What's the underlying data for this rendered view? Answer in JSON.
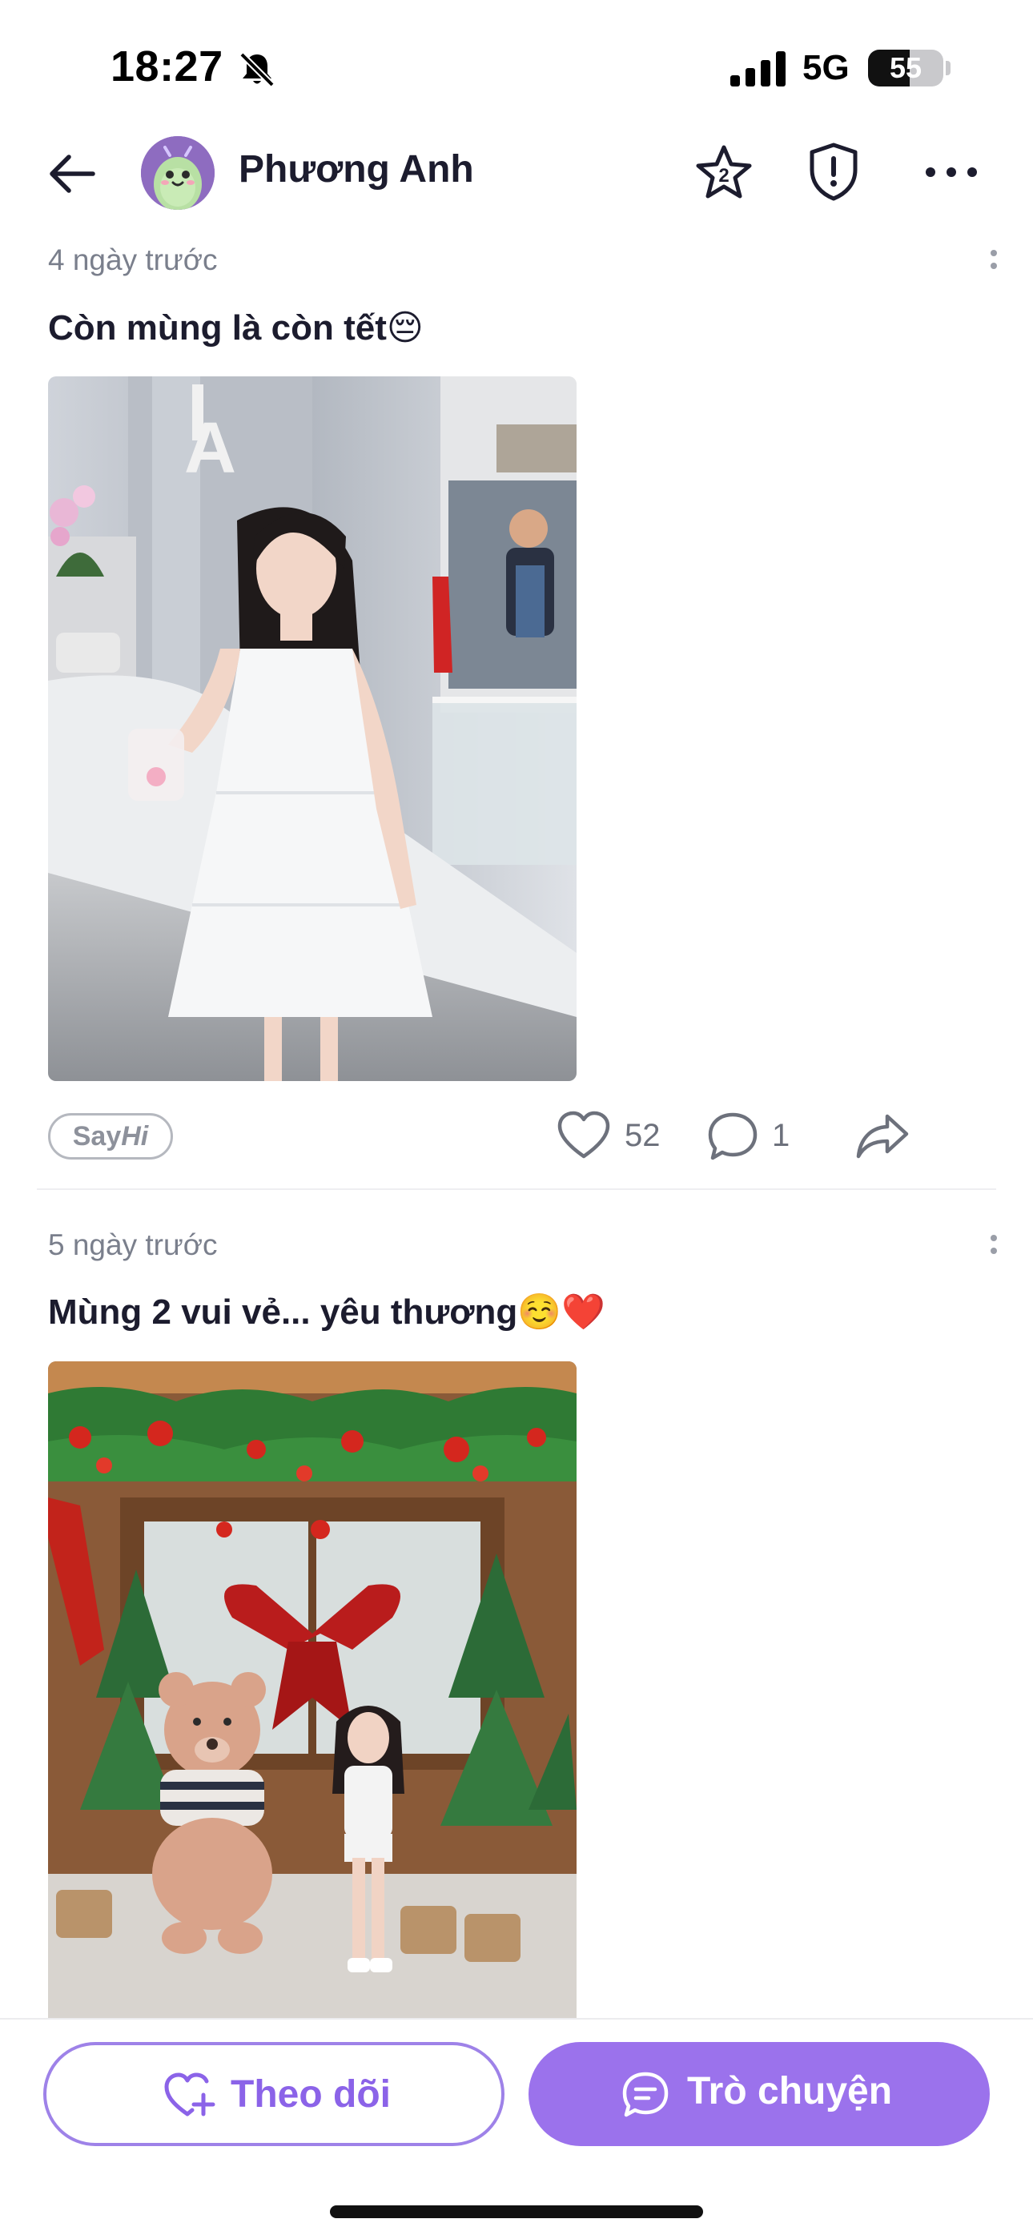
{
  "status_bar": {
    "time": "18:27",
    "network": "5G",
    "battery_level": "55",
    "battery_fraction": 0.55
  },
  "header": {
    "profile_name": "Phương Anh",
    "star_badge": "2"
  },
  "posts": [
    {
      "time": "4 ngày trước",
      "caption": "Còn mùng là còn tết😔",
      "sayhi_prefix": "Say",
      "sayhi_suffix": "Hi",
      "likes": "52",
      "comments": "1"
    },
    {
      "time": "5 ngày trước",
      "caption": "Mùng 2 vui vẻ... yêu thương☺️❤️"
    }
  ],
  "bottom_bar": {
    "follow_label": "Theo dõi",
    "chat_label": "Trò chuyện"
  },
  "colors": {
    "accent": "#9b72ec",
    "accent_text": "#8b63e8",
    "muted_text": "#7a7f8c"
  },
  "icons": [
    "back-arrow-icon",
    "bell-slash-icon",
    "signal-icon",
    "star-icon",
    "shield-alert-icon",
    "more-horizontal-icon",
    "heart-icon",
    "comment-icon",
    "share-icon",
    "heart-plus-icon",
    "chat-bubble-icon"
  ]
}
